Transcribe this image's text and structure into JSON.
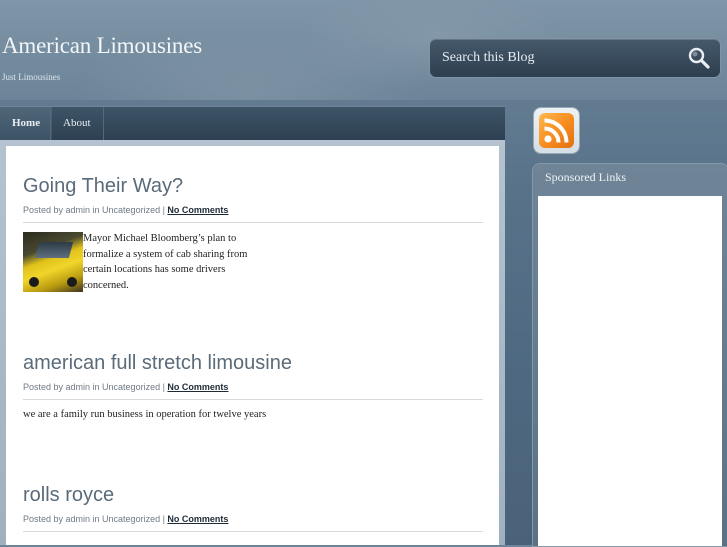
{
  "site": {
    "title": "American Limousines",
    "description": "Just Limousines"
  },
  "search": {
    "placeholder": "Search this Blog",
    "button_icon": "search-icon"
  },
  "nav": {
    "items": [
      {
        "label": "Home",
        "active": true
      },
      {
        "label": "About",
        "active": false
      }
    ]
  },
  "posts": [
    {
      "title": "Going Their Way?",
      "meta_prefix": "Posted by admin in Uncategorized | ",
      "comments": "No Comments",
      "excerpt": "Mayor Michael Bloomberg’s plan to formalize a system of cab sharing from certain locations has some drivers concerned.",
      "has_thumbnail": true
    },
    {
      "title": "american full stretch limousine",
      "meta_prefix": "Posted by admin in Uncategorized | ",
      "comments": "No Comments",
      "excerpt": "we are a family run business in operation for twelve years"
    },
    {
      "title": "rolls royce",
      "meta_prefix": "Posted by admin in Uncategorized | ",
      "comments": "No Comments"
    }
  ],
  "sidebar": {
    "rss_icon": "rss-feed-icon",
    "sponsored_title": "Sponsored Links"
  },
  "colors": {
    "background": "#58728a",
    "post_title": "#5a6b7a",
    "rss_orange": "#f78b1e"
  }
}
